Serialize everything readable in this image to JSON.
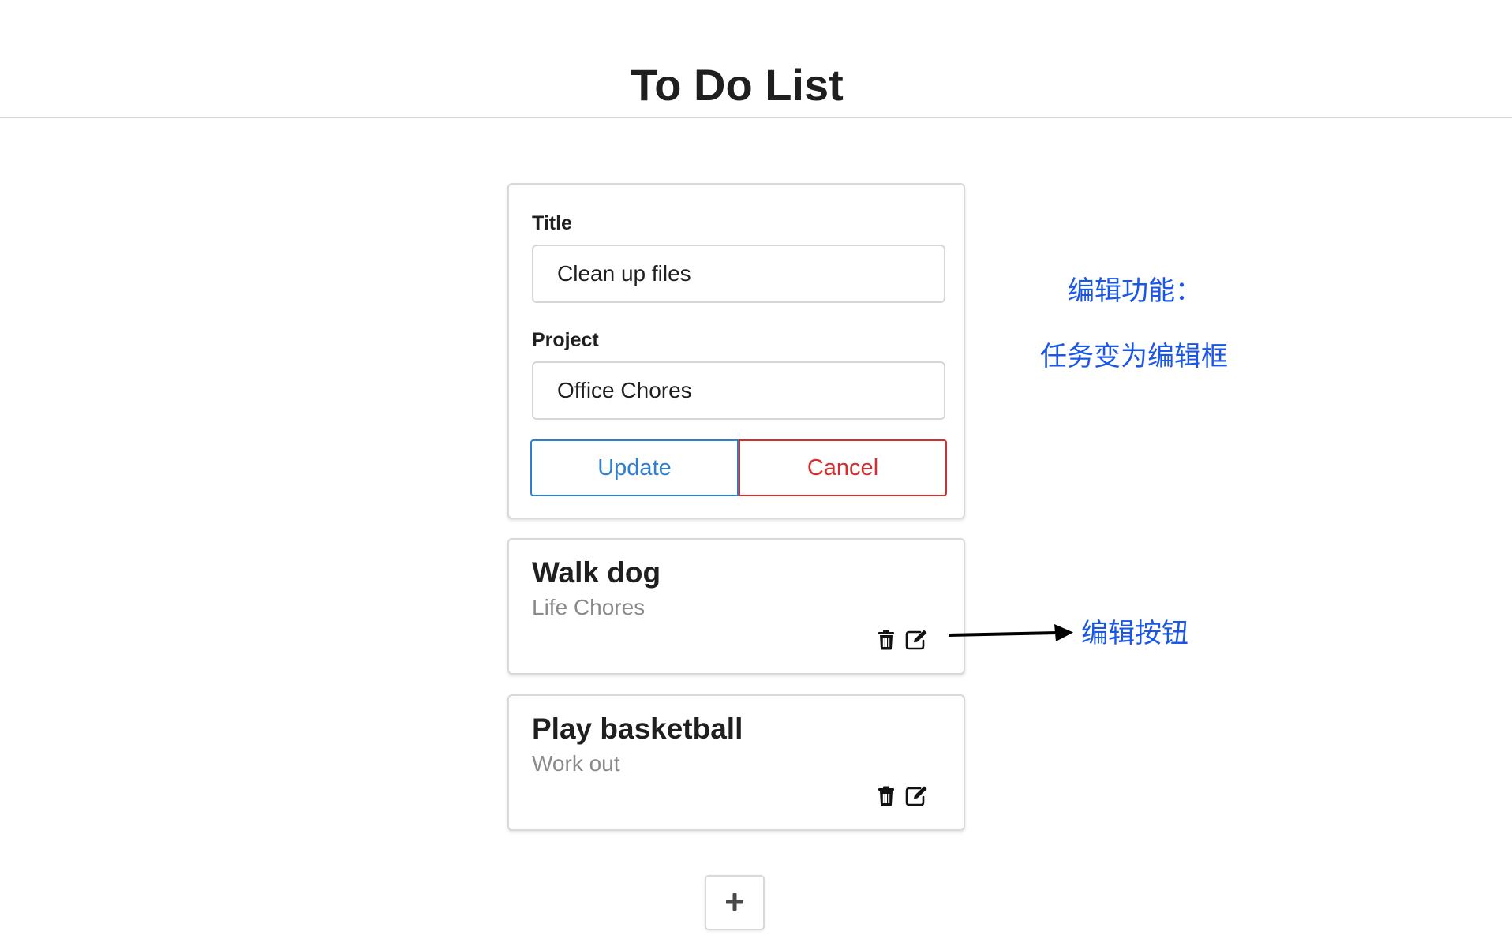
{
  "header": {
    "title": "To Do List"
  },
  "edit_form": {
    "title_label": "Title",
    "title_value": "Clean up files",
    "project_label": "Project",
    "project_value": "Office Chores",
    "update_label": "Update",
    "cancel_label": "Cancel"
  },
  "tasks": [
    {
      "title": "Walk dog",
      "project": "Life Chores"
    },
    {
      "title": "Play basketball",
      "project": "Work out"
    }
  ],
  "icons": {
    "delete": "trash-icon",
    "edit": "edit-icon",
    "add": "plus-icon"
  },
  "annotations": {
    "edit_feature": "编辑功能：",
    "edit_feature_desc": "任务变为编辑框",
    "edit_button": "编辑按钮"
  },
  "colors": {
    "update": "#2f7fd1",
    "cancel": "#d32f2f",
    "annotation": "#1a56e8",
    "muted_text": "#8a8a8a"
  }
}
